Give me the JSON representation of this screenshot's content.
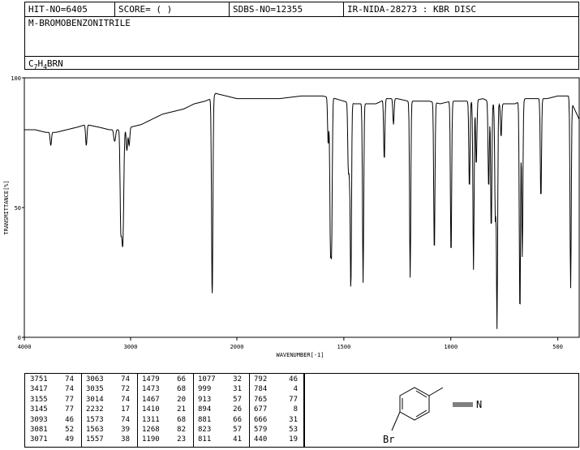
{
  "header": {
    "hit_no": "HIT-NO=6405",
    "score": "SCORE=  (   )",
    "sdbs_no": "SDBS-NO=12355",
    "ir_nida": "IR-NIDA-28273 : KBR DISC"
  },
  "compound_name": "M-BROMOBENZONITRILE",
  "formula": {
    "c": "C",
    "c_sub": "7",
    "h": "H",
    "h_sub": "4",
    "rest": "BRN"
  },
  "structure": {
    "br_label": "Br",
    "n_label": "N"
  },
  "chart_data": {
    "type": "line",
    "xlabel": "WAVENUMBER[-1]",
    "ylabel": "TRANSMITTANCE[%]",
    "xlim": [
      4000,
      400
    ],
    "ylim": [
      0,
      100
    ],
    "x_ticks": [
      4000,
      3000,
      2000,
      1500,
      1000,
      500
    ],
    "y_ticks": [
      0,
      50,
      100
    ],
    "baseline": [
      [
        4000,
        80
      ],
      [
        3900,
        80
      ],
      [
        3800,
        79
      ],
      [
        3700,
        79
      ],
      [
        3600,
        80
      ],
      [
        3500,
        81
      ],
      [
        3420,
        82
      ],
      [
        3300,
        81
      ],
      [
        3200,
        80
      ],
      [
        3100,
        80
      ],
      [
        3000,
        81
      ],
      [
        2900,
        82
      ],
      [
        2800,
        84
      ],
      [
        2700,
        86
      ],
      [
        2600,
        87
      ],
      [
        2500,
        88
      ],
      [
        2400,
        90
      ],
      [
        2300,
        91
      ],
      [
        2240,
        92
      ],
      [
        2200,
        94
      ],
      [
        2100,
        93
      ],
      [
        2000,
        92
      ],
      [
        1900,
        92
      ],
      [
        1800,
        92
      ],
      [
        1700,
        93
      ],
      [
        1600,
        93
      ],
      [
        1540,
        92
      ],
      [
        1500,
        91
      ],
      [
        1450,
        90
      ],
      [
        1400,
        90
      ],
      [
        1350,
        90
      ],
      [
        1300,
        92
      ],
      [
        1250,
        92
      ],
      [
        1200,
        91
      ],
      [
        1150,
        91
      ],
      [
        1100,
        91
      ],
      [
        1050,
        90
      ],
      [
        1000,
        91
      ],
      [
        950,
        91
      ],
      [
        900,
        91
      ],
      [
        850,
        92
      ],
      [
        800,
        90
      ],
      [
        750,
        90
      ],
      [
        700,
        90
      ],
      [
        650,
        92
      ],
      [
        600,
        92
      ],
      [
        550,
        92
      ],
      [
        500,
        93
      ],
      [
        450,
        93
      ],
      [
        400,
        84
      ]
    ],
    "peaks": [
      {
        "x": 3751,
        "t": 74
      },
      {
        "x": 3417,
        "t": 74
      },
      {
        "x": 3155,
        "t": 77
      },
      {
        "x": 3145,
        "t": 77
      },
      {
        "x": 3093,
        "t": 46
      },
      {
        "x": 3081,
        "t": 52
      },
      {
        "x": 3071,
        "t": 49
      },
      {
        "x": 3063,
        "t": 74
      },
      {
        "x": 3035,
        "t": 72
      },
      {
        "x": 3014,
        "t": 74
      },
      {
        "x": 2232,
        "t": 17
      },
      {
        "x": 1573,
        "t": 74
      },
      {
        "x": 1563,
        "t": 39
      },
      {
        "x": 1557,
        "t": 38
      },
      {
        "x": 1479,
        "t": 66
      },
      {
        "x": 1473,
        "t": 68
      },
      {
        "x": 1467,
        "t": 20
      },
      {
        "x": 1410,
        "t": 21
      },
      {
        "x": 1311,
        "t": 68
      },
      {
        "x": 1268,
        "t": 82
      },
      {
        "x": 1190,
        "t": 23
      },
      {
        "x": 1077,
        "t": 32
      },
      {
        "x": 999,
        "t": 31
      },
      {
        "x": 913,
        "t": 57
      },
      {
        "x": 894,
        "t": 26
      },
      {
        "x": 881,
        "t": 66
      },
      {
        "x": 823,
        "t": 57
      },
      {
        "x": 811,
        "t": 41
      },
      {
        "x": 792,
        "t": 46
      },
      {
        "x": 784,
        "t": 4
      },
      {
        "x": 765,
        "t": 77
      },
      {
        "x": 677,
        "t": 8
      },
      {
        "x": 666,
        "t": 31
      },
      {
        "x": 579,
        "t": 53
      },
      {
        "x": 440,
        "t": 19
      }
    ]
  },
  "peak_columns": [
    [
      [
        "3751",
        "74"
      ],
      [
        "3417",
        "74"
      ],
      [
        "3155",
        "77"
      ],
      [
        "3145",
        "77"
      ],
      [
        "3093",
        "46"
      ],
      [
        "3081",
        "52"
      ],
      [
        "3071",
        "49"
      ]
    ],
    [
      [
        "3063",
        "74"
      ],
      [
        "3035",
        "72"
      ],
      [
        "3014",
        "74"
      ],
      [
        "2232",
        "17"
      ],
      [
        "1573",
        "74"
      ],
      [
        "1563",
        "39"
      ],
      [
        "1557",
        "38"
      ]
    ],
    [
      [
        "1479",
        "66"
      ],
      [
        "1473",
        "68"
      ],
      [
        "1467",
        "20"
      ],
      [
        "1410",
        "21"
      ],
      [
        "1311",
        "68"
      ],
      [
        "1268",
        "82"
      ],
      [
        "1190",
        "23"
      ]
    ],
    [
      [
        "1077",
        "32"
      ],
      [
        "999",
        "31"
      ],
      [
        "913",
        "57"
      ],
      [
        "894",
        "26"
      ],
      [
        "881",
        "66"
      ],
      [
        "823",
        "57"
      ],
      [
        "811",
        "41"
      ]
    ],
    [
      [
        "792",
        "46"
      ],
      [
        "784",
        "4"
      ],
      [
        "765",
        "77"
      ],
      [
        "677",
        "8"
      ],
      [
        "666",
        "31"
      ],
      [
        "579",
        "53"
      ],
      [
        "440",
        "19"
      ]
    ]
  ]
}
